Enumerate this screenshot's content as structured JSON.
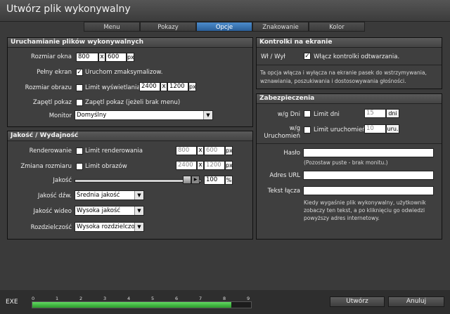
{
  "window": {
    "title": "Utwórz plik wykonywalny"
  },
  "tabs": [
    {
      "label": "Menu",
      "active": false
    },
    {
      "label": "Pokazy",
      "active": false
    },
    {
      "label": "Opcje",
      "active": true
    },
    {
      "label": "Znakowanie",
      "active": false
    },
    {
      "label": "Kolor",
      "active": false
    }
  ],
  "launch": {
    "heading": "Uruchamianie plików wykonywalnych",
    "window_size_label": "Rozmiar okna",
    "window_width": "800",
    "window_height": "600",
    "x": "x",
    "px": "px",
    "fullscreen_label": "Pełny ekran",
    "fullscreen_option": "Uruchom zmaksymalizow.",
    "fullscreen_checked": true,
    "image_size_label": "Rozmiar obrazu",
    "image_size_option": "Limit wyświetlania",
    "image_size_checked": false,
    "image_width": "2400",
    "image_height": "1200",
    "loop_label": "Zapętl pokaz",
    "loop_option": "Zapętl pokaz (jeżeli brak menu)",
    "loop_checked": false,
    "monitor_label": "Monitor",
    "monitor_value": "Domyślny"
  },
  "quality": {
    "heading": "Jakość / Wydajność",
    "render_label": "Renderowanie",
    "render_option": "Limit renderowania",
    "render_checked": false,
    "render_width": "800",
    "render_height": "600",
    "resize_label": "Zmiana rozmiaru",
    "resize_option": "Limit obrazów",
    "resize_checked": false,
    "resize_width": "2400",
    "resize_height": "1200",
    "quality_label": "Jakość",
    "quality_value": "100",
    "quality_fraction": 1.0,
    "percent": "%",
    "audio_label": "Jakość dźw.",
    "audio_value": "Średnia jakość",
    "video_label": "Jakość wideo",
    "video_value": "Wysoka jakość",
    "resolution_label": "Rozdzielczość",
    "resolution_value": "Wysoka rozdzielczo"
  },
  "controls": {
    "heading": "Kontrolki na ekranie",
    "onoff_label": "Wł / Wył",
    "onoff_option": "Włącz kontrolki odtwarzania.",
    "onoff_checked": true,
    "description": "Ta opcja włącza i wyłącza na ekranie pasek do wstrzymywania, wznawiania, poszukiwania i dostosowywania głośności."
  },
  "security": {
    "heading": "Zabezpieczenia",
    "days_label": "w/g Dni",
    "days_option": "Limit dni",
    "days_checked": false,
    "days_value": "15",
    "days_unit": "dni",
    "runs_label_1": "w/g",
    "runs_label_2": "Uruchomień",
    "runs_option": "Limit uruchomień",
    "runs_checked": false,
    "runs_value": "10",
    "runs_unit": "uru.",
    "password_label": "Hasło",
    "password_value": "",
    "password_hint": "(Pozostaw puste - brak monitu.)",
    "url_label": "Adres URL",
    "url_value": "",
    "link_label": "Tekst łącza",
    "link_value": "",
    "expiry_note": "Kiedy wygaśnie plik wykonywalny, użytkownik zobaczy ten tekst, a po kliknięciu go odwiedzi powyższy adres internetowy."
  },
  "footer": {
    "exe_label": "EXE",
    "scale": [
      "0",
      "1",
      "2",
      "3",
      "4",
      "5",
      "6",
      "7",
      "8",
      "9"
    ],
    "progress_fraction": 0.91,
    "create_button": "Utwórz",
    "cancel_button": "Anuluj"
  },
  "colors": {
    "accent": "#3a78b8",
    "background": "#3a3a3a",
    "meter": "#4cc24c"
  }
}
